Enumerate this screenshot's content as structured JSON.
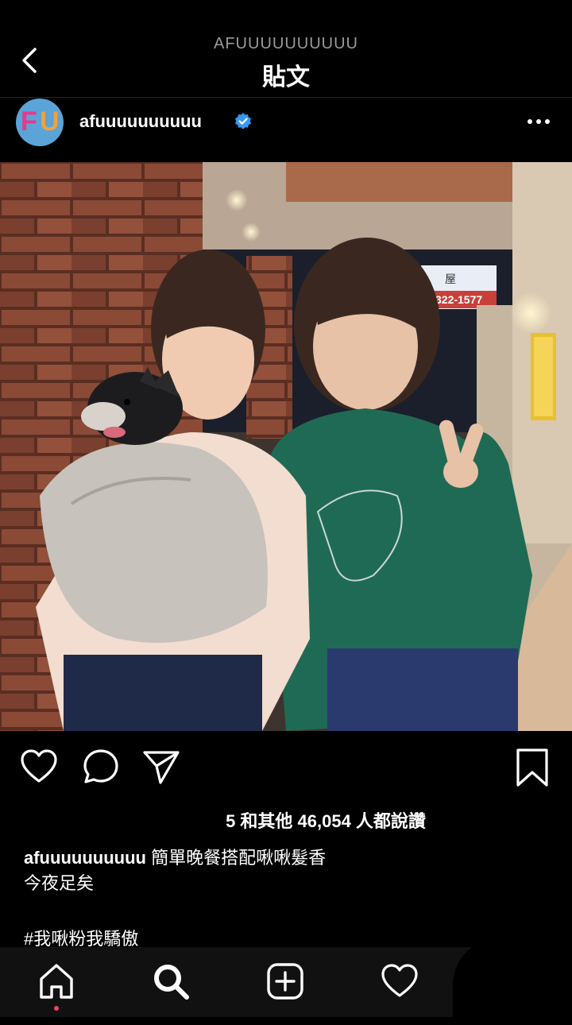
{
  "header": {
    "subtitle": "AFUUUUUUUUUU",
    "title": "貼文"
  },
  "post": {
    "username": "afuuuuuuuuuu",
    "verified": true,
    "likes_text": "5 和其他 46,054 人都說讚",
    "caption_user": "afuuuuuuuuuu",
    "caption_line1": "簡單晚餐搭配啾啾髮香",
    "caption_line2": "今夜足矣",
    "hashtag": "#我啾粉我驕傲",
    "avatar_letters": {
      "left": "F",
      "right": "U"
    },
    "photo_sign": {
      "number": "322-1577",
      "char": "屋"
    }
  },
  "icons": {
    "back": "chevron-left-icon",
    "more": "more-dots-icon",
    "like": "heart-icon",
    "comment": "comment-icon",
    "share": "send-icon",
    "save": "bookmark-icon",
    "nav": [
      "home-icon",
      "search-icon",
      "add-post-icon",
      "activity-heart-icon"
    ]
  },
  "colors": {
    "background": "#000000",
    "verified_blue": "#3897f0",
    "notification_red": "#ed4956"
  }
}
